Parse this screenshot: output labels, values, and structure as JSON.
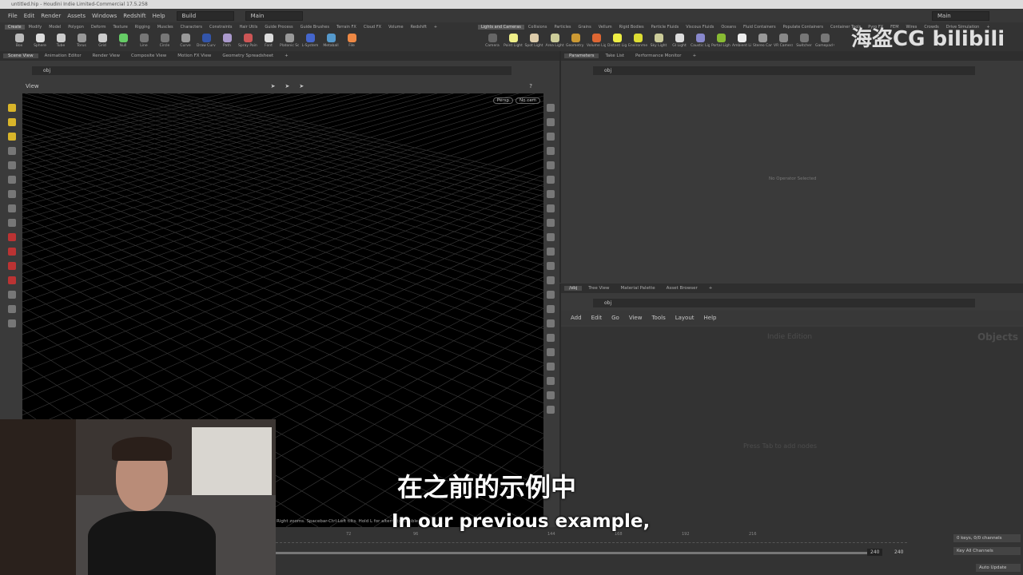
{
  "window_title": "untitled.hip - Houdini Indie Limited-Commercial 17.5.258",
  "menu": [
    "File",
    "Edit",
    "Render",
    "Assets",
    "Windows",
    "Redshift",
    "Help"
  ],
  "desktop": "Build",
  "context": "Main",
  "right_context": "Main",
  "shelf_tabs_left": [
    "Create",
    "Modify",
    "Model",
    "Polygon",
    "Deform",
    "Texture",
    "Rigging",
    "Muscles",
    "Characters",
    "Constraints",
    "Hair Utils",
    "Guide Process",
    "Guide Brushes",
    "Terrain FX",
    "Cloud FX",
    "Volume",
    "Redshift"
  ],
  "shelf_tools_left": [
    "Box",
    "Sphere",
    "Tube",
    "Torus",
    "Grid",
    "Null",
    "Line",
    "Circle",
    "Curve",
    "Draw Curve",
    "Path",
    "Spray Paint",
    "Font",
    "Platonic Solids",
    "L-System",
    "Metaball",
    "File"
  ],
  "shelf_tabs_right": [
    "Lights and Cameras",
    "Collisions",
    "Particles",
    "Grains",
    "Vellum",
    "Rigid Bodies",
    "Particle Fluids",
    "Viscous Fluids",
    "Oceans",
    "Fluid Containers",
    "Populate Containers",
    "Container Tools",
    "Pyro FX",
    "FEM",
    "Wires",
    "Crowds",
    "Drive Simulation"
  ],
  "shelf_tools_right": [
    "Camera",
    "Point Light",
    "Spot Light",
    "Area Light",
    "Geometry Light",
    "Volume Light",
    "Distant Light",
    "Environment Light",
    "Sky Light",
    "GI Light",
    "Caustic Light",
    "Portal Light",
    "Ambient Light",
    "Stereo Camera",
    "VR Camera",
    "Switcher",
    "Gamepad Camera"
  ],
  "left_tabs": [
    "Scene View",
    "Animation Editor",
    "Render View",
    "Composite View",
    "Motion FX View",
    "Geometry Spreadsheet"
  ],
  "path": "obj",
  "view_label": "View",
  "persp": "Persp",
  "cam": "No cam",
  "status_hint": "Right zooms. Spacebar-Ctrl-Left tilts. Hold L for alternate tumble.",
  "param_tabs": [
    "Parameters",
    "Take List",
    "Performance Monitor"
  ],
  "no_operator": "No Operator Selected",
  "net_tabs": [
    "/obj",
    "Tree View",
    "Material Palette",
    "Asset Browser"
  ],
  "net_menu": [
    "Add",
    "Edit",
    "Go",
    "View",
    "Tools",
    "Layout",
    "Help"
  ],
  "net_watermark": "Objects",
  "net_ghost_title": "Indie Edition",
  "net_ghost_hint": "Press Tab to add nodes",
  "timeline_ticks": [
    "72",
    "96",
    "144",
    "168",
    "192",
    "216"
  ],
  "frame_end": "240",
  "frame_end2": "240",
  "keys_status": "0 keys, 0/0 channels",
  "key_all": "Key All Channels",
  "auto_update": "Auto Update",
  "subtitle_cn": "在之前的示例中",
  "subtitle_en": "In our previous example,",
  "watermark": "海盗CG bilibili"
}
